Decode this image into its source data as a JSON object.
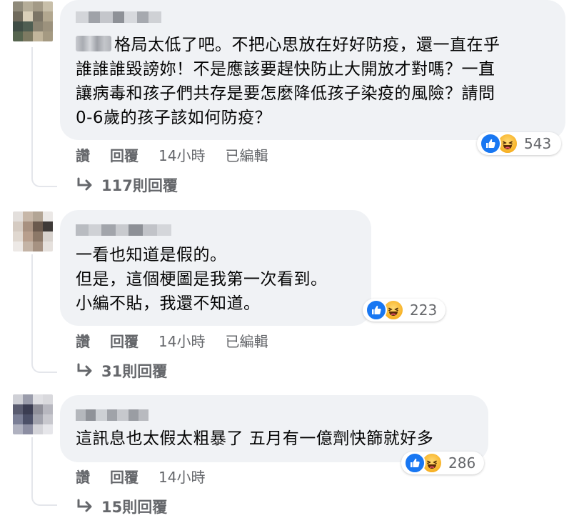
{
  "comments": [
    {
      "lines": [
        "格局太低了吧。不把心思放在好好防疫，還一直在乎",
        "誰誰誰毀謗妳！不是應該要趕快防止大開放才對嗎？一直",
        "讓病毒和孩子們共存是要怎麼降低孩子染疫的風險？請問",
        "0-6歲的孩子該如何防疫？"
      ],
      "reaction_count": "543",
      "actions": {
        "like": "讚",
        "reply": "回覆",
        "time": "14小時",
        "edited": "已編輯"
      },
      "replies_label": "117則回覆"
    },
    {
      "lines": [
        "一看也知道是假的。",
        "但是，這個梗圖是我第一次看到。",
        "小編不貼，我還不知道。"
      ],
      "reaction_count": "223",
      "actions": {
        "like": "讚",
        "reply": "回覆",
        "time": "14小時",
        "edited": "已編輯"
      },
      "replies_label": "31則回覆"
    },
    {
      "lines": [
        "這訊息也太假太粗暴了 五月有一億劑快篩就好多"
      ],
      "reaction_count": "286",
      "actions": {
        "like": "讚",
        "reply": "回覆",
        "time": "14小時"
      },
      "replies_label": "15則回覆"
    }
  ],
  "icons": {
    "like": "thumbs-up-icon",
    "haha": "haha-face-icon",
    "reply_arrow": "reply-arrow-icon"
  },
  "colors": {
    "like_blue": "#1877f2",
    "haha_yellow": "#f7b125",
    "bubble_bg": "#f0f2f5",
    "meta_gray": "#65676b"
  }
}
